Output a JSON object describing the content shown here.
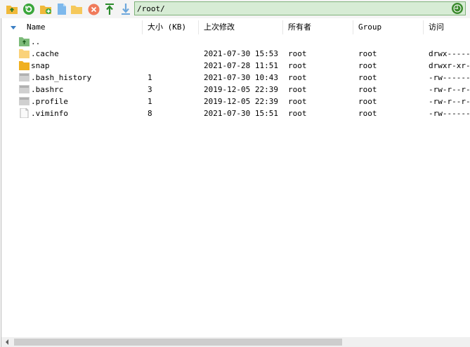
{
  "toolbar": {
    "buttons": [
      {
        "name": "up-folder-icon"
      },
      {
        "name": "refresh-icon"
      },
      {
        "name": "new-folder-icon"
      },
      {
        "name": "new-file-icon"
      },
      {
        "name": "open-folder-icon"
      },
      {
        "name": "delete-icon"
      },
      {
        "name": "upload-icon"
      },
      {
        "name": "download-icon"
      }
    ],
    "path_value": "/root/"
  },
  "columns": {
    "name": "Name",
    "size": "大小 (KB)",
    "modified": "上次修改",
    "owner": "所有者",
    "group": "Group",
    "access": "访问"
  },
  "files": [
    {
      "name": "..",
      "icon": "parent-folder-icon",
      "size": "",
      "modified": "",
      "owner": "",
      "group": "",
      "access": ""
    },
    {
      "name": ".cache",
      "icon": "folder-icon",
      "size": "",
      "modified": "2021-07-30 15:53",
      "owner": "root",
      "group": "root",
      "access": "drwx------"
    },
    {
      "name": "snap",
      "icon": "folder-icon",
      "size": "",
      "modified": "2021-07-28 11:51",
      "owner": "root",
      "group": "root",
      "access": "drwxr-xr-x"
    },
    {
      "name": ".bash_history",
      "icon": "file-icon",
      "size": "1",
      "modified": "2021-07-30 10:43",
      "owner": "root",
      "group": "root",
      "access": "-rw-------"
    },
    {
      "name": ".bashrc",
      "icon": "file-icon",
      "size": "3",
      "modified": "2019-12-05 22:39",
      "owner": "root",
      "group": "root",
      "access": "-rw-r--r--"
    },
    {
      "name": ".profile",
      "icon": "file-icon",
      "size": "1",
      "modified": "2019-12-05 22:39",
      "owner": "root",
      "group": "root",
      "access": "-rw-r--r--"
    },
    {
      "name": ".viminfo",
      "icon": "document-icon",
      "size": "8",
      "modified": "2021-07-30 15:51",
      "owner": "root",
      "group": "root",
      "access": "-rw-------"
    }
  ],
  "colors": {
    "path_bg": "#d7ecd5",
    "folder": "#f5c242",
    "accent": "#3b7fc4"
  }
}
